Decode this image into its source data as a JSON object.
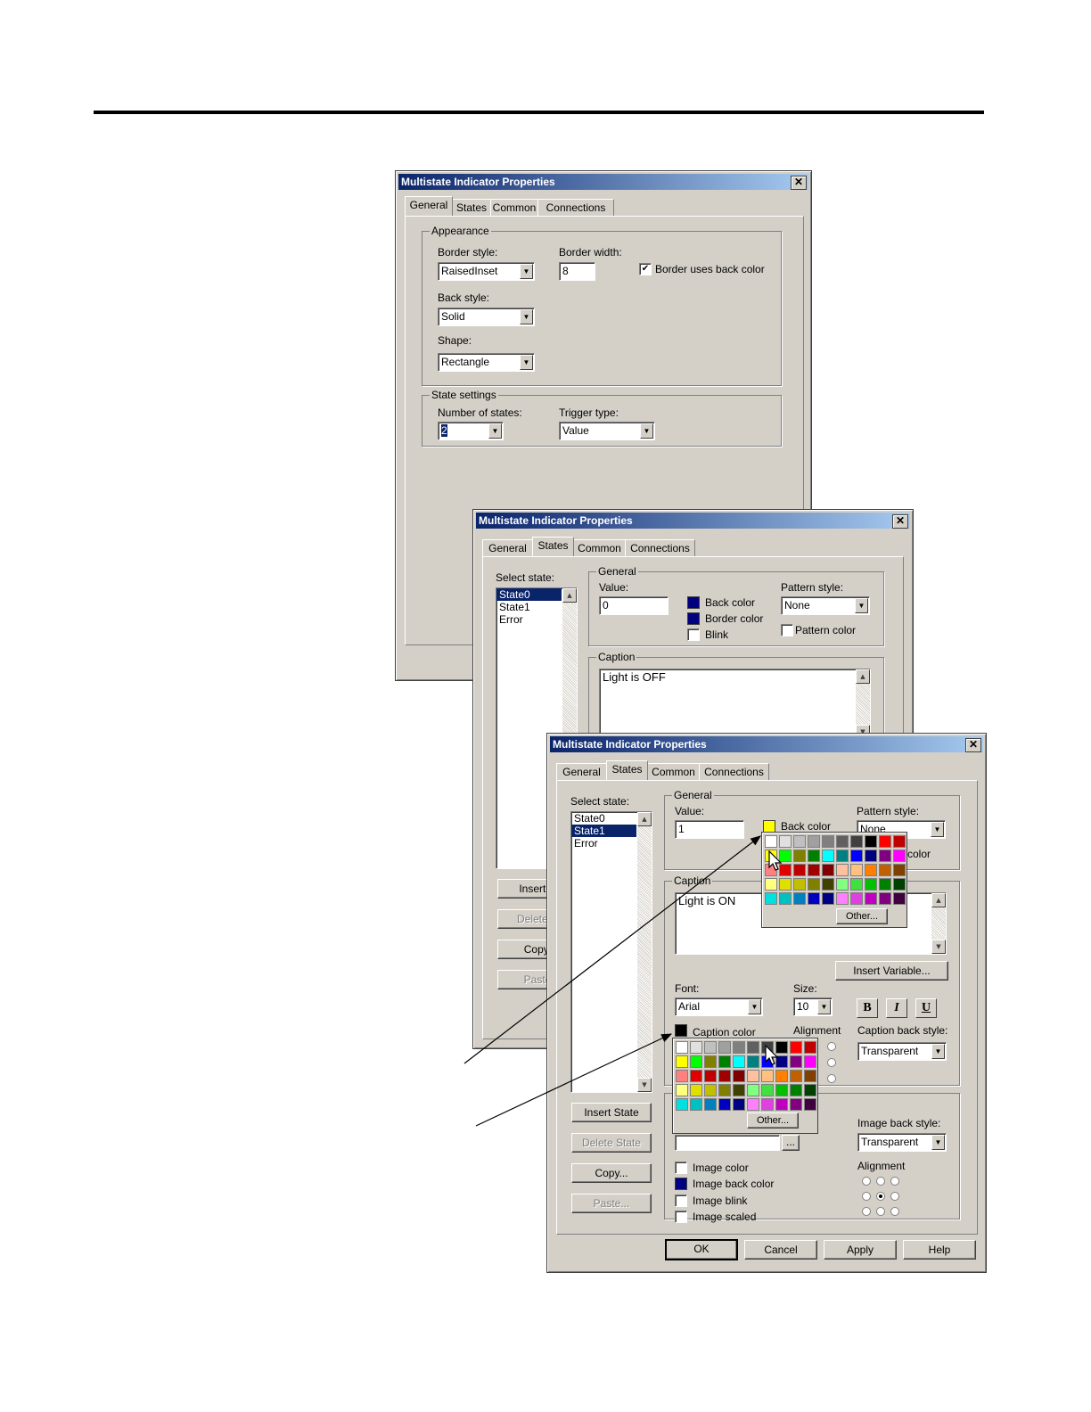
{
  "dialog_title": "Multistate Indicator Properties",
  "tabs": [
    "General",
    "States",
    "Common",
    "Connections"
  ],
  "general_tab": {
    "appearance_label": "Appearance",
    "border_style_label": "Border style:",
    "border_style_value": "RaisedInset",
    "border_width_label": "Border width:",
    "border_width_value": "8",
    "border_uses_back_color_label": "Border uses back color",
    "border_uses_back_color_checked": "✔",
    "back_style_label": "Back style:",
    "back_style_value": "Solid",
    "shape_label": "Shape:",
    "shape_value": "Rectangle",
    "state_settings_label": "State settings",
    "number_of_states_label": "Number of states:",
    "number_of_states_value": "2",
    "trigger_type_label": "Trigger type:",
    "trigger_type_value": "Value"
  },
  "states_tab_1": {
    "select_state_label": "Select state:",
    "states": [
      "State0",
      "State1",
      "Error"
    ],
    "general_label": "General",
    "value_label": "Value:",
    "value": "0",
    "back_color_label": "Back color",
    "border_color_label": "Border color",
    "blink_label": "Blink",
    "pattern_style_label": "Pattern style:",
    "pattern_style_value": "None",
    "pattern_color_label": "Pattern color",
    "caption_label": "Caption",
    "caption_text": "Light is OFF",
    "buttons_partial": [
      "Insert S",
      "Delete S",
      "Copy.",
      "Paste"
    ]
  },
  "states_tab_2": {
    "select_state_label": "Select state:",
    "states": [
      "State0",
      "State1",
      "Error"
    ],
    "general_label": "General",
    "value_label": "Value:",
    "value": "1",
    "back_color_label": "Back color",
    "pattern_style_label": "Pattern style:",
    "pattern_style_value": "None",
    "pattern_color_partial": "color",
    "caption_label": "Caption",
    "caption_text": "Light is ON",
    "insert_variable_label": "Insert Variable...",
    "font_label": "Font:",
    "font_value": "Arial",
    "size_label": "Size:",
    "size_value": "10",
    "bold_label": "B",
    "italic_label": "I",
    "underline_label": "U",
    "caption_color_label": "Caption color",
    "alignment_label": "Alignment",
    "caption_back_style_label": "Caption back style:",
    "caption_back_style_value": "Transparent",
    "image_back_style_label": "Image back style:",
    "image_back_style_value": "Transparent",
    "image_alignment_label": "Alignment",
    "image_color_label": "Image color",
    "image_back_color_label": "Image back color",
    "image_blink_label": "Image blink",
    "image_scaled_label": "Image scaled",
    "browse_label": "...",
    "insert_state_label": "Insert State",
    "delete_state_label": "Delete State",
    "copy_label": "Copy...",
    "paste_label": "Paste...",
    "ok_label": "OK",
    "cancel_label": "Cancel",
    "apply_label": "Apply",
    "help_label": "Help",
    "other_label": "Other..."
  },
  "colors": {
    "back_color_swatch": "#ffff00",
    "navy": "#000080",
    "black": "#000000",
    "palette": [
      [
        "#ffffff",
        "#e0e0e0",
        "#c0c0c0",
        "#a0a0a0",
        "#808080",
        "#606060",
        "#404040",
        "#000000",
        "#ff0000",
        "#c00000"
      ],
      [
        "#ffff00",
        "#00ff00",
        "#808000",
        "#008000",
        "#00ffff",
        "#008080",
        "#0000ff",
        "#000080",
        "#800080",
        "#ff00ff"
      ],
      [
        "#ff8080",
        "#e00000",
        "#c00000",
        "#a00000",
        "#800000",
        "#ffc0a0",
        "#ffc080",
        "#ff8000",
        "#c06000",
        "#804000"
      ],
      [
        "#ffff80",
        "#e0e000",
        "#c0c000",
        "#808000",
        "#404000",
        "#80ff80",
        "#40e040",
        "#00c000",
        "#008000",
        "#004000"
      ],
      [
        "#00e0e0",
        "#00c0c0",
        "#0080c0",
        "#0000c0",
        "#000080",
        "#ff80ff",
        "#e040e0",
        "#c000c0",
        "#800080",
        "#400040"
      ]
    ]
  }
}
